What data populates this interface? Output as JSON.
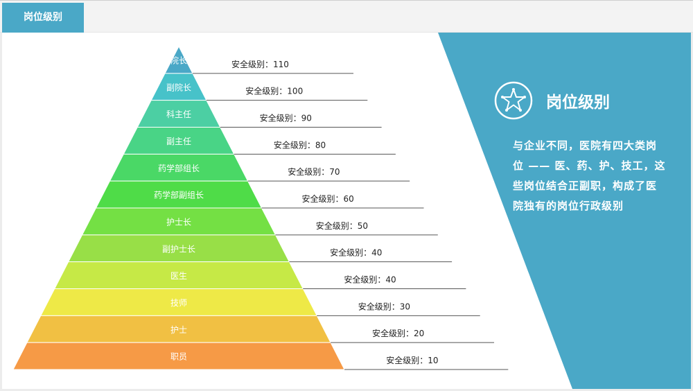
{
  "header": {
    "tab_label": "岗位级别"
  },
  "panel": {
    "title": "岗位级别",
    "description": "与企业不同，医院有四大类岗位 —— 医、药、护、技工，这些岗位结合正副职，构成了医院独有的岗位行政级别",
    "icon": "star-badge-icon",
    "color": "#4aa8c7"
  },
  "levels": [
    {
      "name": "院长",
      "label": "安全级别：110",
      "color": "#4aa8c7"
    },
    {
      "name": "副院长",
      "label": "安全级别：100",
      "color": "#47c2c9"
    },
    {
      "name": "科主任",
      "label": "安全级别：90",
      "color": "#4ccfa3"
    },
    {
      "name": "副主任",
      "label": "安全级别：80",
      "color": "#49d486"
    },
    {
      "name": "药学部组长",
      "label": "安全级别：70",
      "color": "#4ad866"
    },
    {
      "name": "药学部副组长",
      "label": "安全级别：60",
      "color": "#4fdc48"
    },
    {
      "name": "护士长",
      "label": "安全级别：50",
      "color": "#74e044"
    },
    {
      "name": "副护士长",
      "label": "安全级别：40",
      "color": "#98df47"
    },
    {
      "name": "医生",
      "label": "安全级别：40",
      "color": "#c6e946"
    },
    {
      "name": "技师",
      "label": "安全级别：30",
      "color": "#eee947"
    },
    {
      "name": "护士",
      "label": "安全级别：20",
      "color": "#f1c043"
    },
    {
      "name": "职员",
      "label": "安全级别：10",
      "color": "#f69a46"
    }
  ]
}
